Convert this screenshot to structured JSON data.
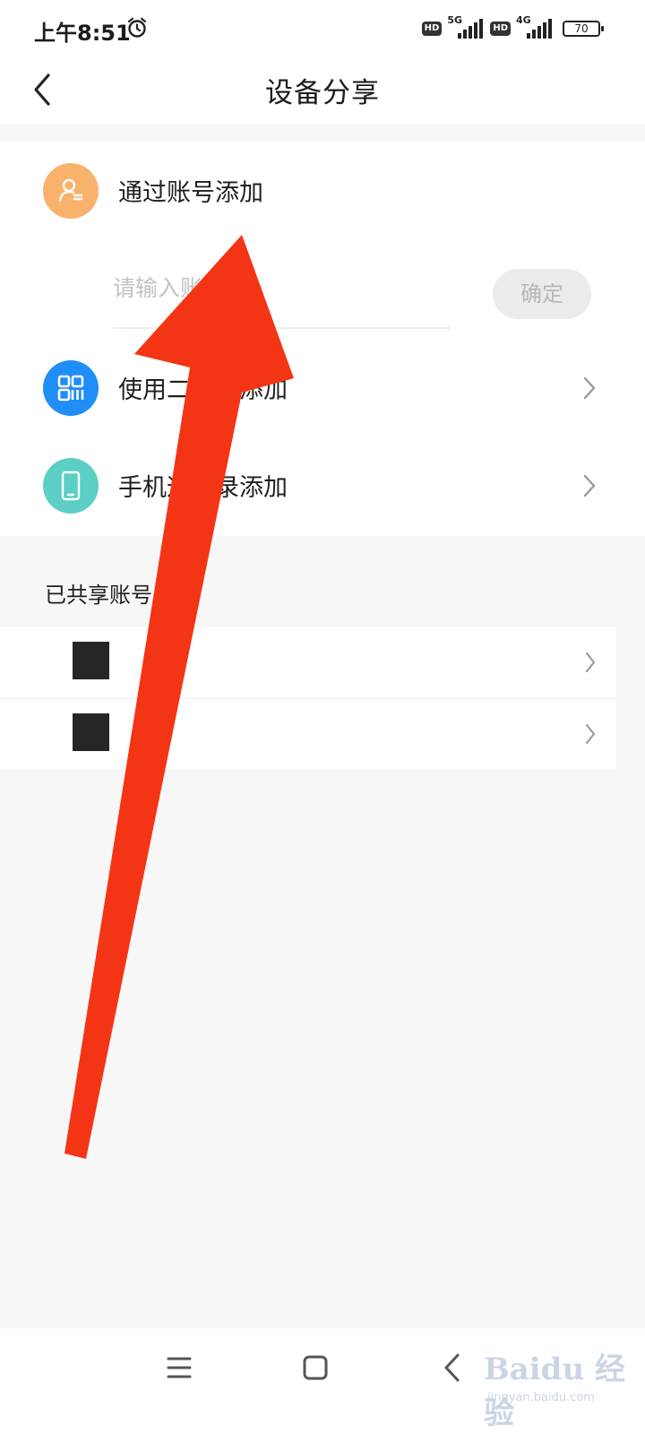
{
  "status_bar": {
    "time": "上午8:51",
    "hd1": "HD",
    "net1": "5G",
    "hd2": "HD",
    "net2": "4G",
    "battery": "70"
  },
  "header": {
    "title": "设备分享"
  },
  "options": [
    {
      "label": "通过账号添加",
      "icon": "person-icon",
      "color": "#f9b26c"
    },
    {
      "label": "使用二维码添加",
      "icon": "qr-code-icon",
      "color": "#1f8ef7"
    },
    {
      "label": "手机通讯录添加",
      "icon": "phone-icon",
      "color": "#5bcfc4"
    }
  ],
  "account_input": {
    "placeholder": "请输入账号",
    "value": ""
  },
  "confirm_button": "确定",
  "shared_section": {
    "title": "已共享账号"
  },
  "colors": {
    "arrow": "#f43515",
    "background": "#f7f7f7"
  },
  "watermark": {
    "logo": "Baidu 经验",
    "url": "jingyan.baidu.com"
  }
}
